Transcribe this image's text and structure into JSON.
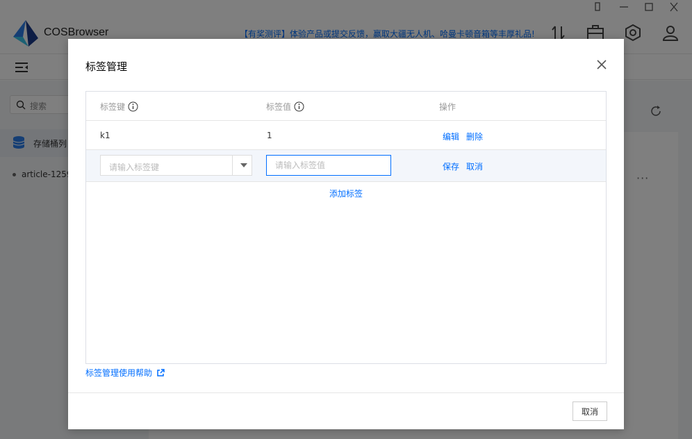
{
  "app": {
    "name": "COSBrowser",
    "promo_text": "【有奖测评】体验产品或提交反馈，赢取大疆无人机、哈曼卡顿音箱等丰厚礼品!",
    "search_placeholder": "搜索",
    "sidebar_item": "存储桶列",
    "bucket_name": "article-1259",
    "more_label": "···"
  },
  "dialog": {
    "title": "标签管理",
    "columns": {
      "key": "标签键",
      "value": "标签值",
      "actions": "操作"
    },
    "rows": [
      {
        "key": "k1",
        "value": "1",
        "edit": "编辑",
        "delete": "删除"
      }
    ],
    "edit_row": {
      "key_placeholder": "请输入标签键",
      "value_placeholder": "请输入标签值",
      "save": "保存",
      "cancel": "取消"
    },
    "add_tag": "添加标签",
    "help_link": "标签管理使用帮助",
    "cancel_button": "取消"
  },
  "colors": {
    "accent": "#006eff",
    "overlay": "rgba(0,0,0,0.5)"
  }
}
